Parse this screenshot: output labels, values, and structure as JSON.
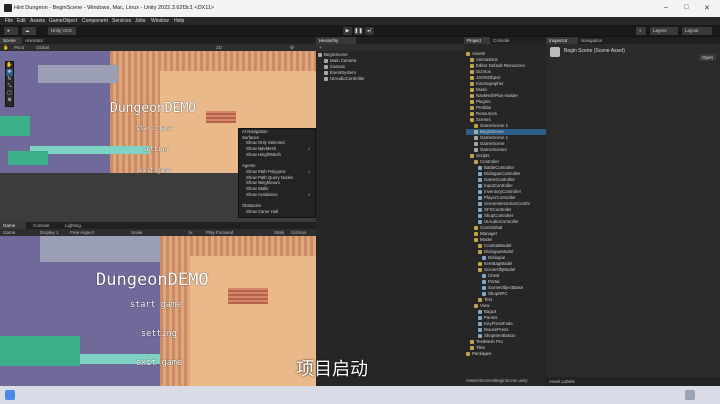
{
  "window": {
    "title": "Hint Dungeon - BeginScene - Windows, Mac, Linux - Unity 2022.3.62f3c1 <DX11>"
  },
  "menu": [
    "File",
    "Edit",
    "Assets",
    "GameObject",
    "Component",
    "Services",
    "Jobs",
    "Window",
    "Help"
  ],
  "toolbar": {
    "account": "Unity VCS",
    "layers": "Layers",
    "layout": "Layout"
  },
  "scene_panel": {
    "tabs": [
      "Scene",
      "Animator"
    ],
    "pivot": "Pivot",
    "global": "Global",
    "mode_2d": "2D"
  },
  "game_panel": {
    "tabs": [
      "Game",
      "Console",
      "Lighting"
    ],
    "display": "Display 1",
    "aspect": "Free Aspect",
    "scale_label": "Scale",
    "scale_value": "1x",
    "play_mode": "Play Focused",
    "stats": "Stats",
    "gizmos": "Gizmos"
  },
  "game_ui": {
    "title": "DungeonDEMO",
    "start": "start game",
    "setting": "setting",
    "exit": "exit game"
  },
  "gizmo_menu": [
    {
      "label": "AI Navigation",
      "header": true,
      "checked": false
    },
    {
      "label": "Surfaces",
      "header": true,
      "checked": false
    },
    {
      "label": "Show Only Selected",
      "header": false,
      "checked": false
    },
    {
      "label": "Show NavMesh",
      "header": false,
      "checked": true
    },
    {
      "label": "Show HeightMesh",
      "header": false,
      "checked": false
    },
    {
      "label": "",
      "header": false,
      "checked": false
    },
    {
      "label": "Agents",
      "header": true,
      "checked": false
    },
    {
      "label": "Show Path Polygons",
      "header": false,
      "checked": true
    },
    {
      "label": "Show Path Query Nodes",
      "header": false,
      "checked": false
    },
    {
      "label": "Show Neighbours",
      "header": false,
      "checked": false
    },
    {
      "label": "Show Walls",
      "header": false,
      "checked": false
    },
    {
      "label": "Show Avoidance",
      "header": false,
      "checked": true
    },
    {
      "label": "",
      "header": false,
      "checked": false
    },
    {
      "label": "Obstacles",
      "header": true,
      "checked": false
    },
    {
      "label": "Show Carve Hull",
      "header": false,
      "checked": false
    }
  ],
  "hierarchy": {
    "tab": "Hierarchy",
    "items": [
      {
        "label": "BeginScene",
        "depth": 0,
        "type": "g"
      },
      {
        "label": "Main Camera",
        "depth": 1,
        "type": "g"
      },
      {
        "label": "Canvas",
        "depth": 1,
        "type": "g"
      },
      {
        "label": "EventSystem",
        "depth": 1,
        "type": "g"
      },
      {
        "label": "UIAudioController",
        "depth": 1,
        "type": "g"
      }
    ]
  },
  "project": {
    "tabs": [
      "Project",
      "Console"
    ],
    "items": [
      {
        "label": "Assets",
        "depth": 0,
        "type": "f",
        "sel": false
      },
      {
        "label": "Animations",
        "depth": 1,
        "type": "f",
        "sel": false
      },
      {
        "label": "Editor Default Resources",
        "depth": 1,
        "type": "f",
        "sel": false
      },
      {
        "label": "Gizmos",
        "depth": 1,
        "type": "f",
        "sel": false
      },
      {
        "label": "JSONObject",
        "depth": 1,
        "type": "f",
        "sel": false
      },
      {
        "label": "Kinetographer",
        "depth": 1,
        "type": "f",
        "sel": false
      },
      {
        "label": "Music",
        "depth": 1,
        "type": "f",
        "sel": false
      },
      {
        "label": "NavMeshPlus-master",
        "depth": 1,
        "type": "f",
        "sel": false
      },
      {
        "label": "Plugins",
        "depth": 1,
        "type": "f",
        "sel": false
      },
      {
        "label": "Prefabs",
        "depth": 1,
        "type": "f",
        "sel": false
      },
      {
        "label": "Resources",
        "depth": 1,
        "type": "f",
        "sel": false
      },
      {
        "label": "Scenes",
        "depth": 1,
        "type": "f",
        "sel": false
      },
      {
        "label": "GameScene 1",
        "depth": 2,
        "type": "f",
        "sel": false
      },
      {
        "label": "BeginScene",
        "depth": 2,
        "type": "g",
        "sel": true
      },
      {
        "label": "GameScene 1",
        "depth": 2,
        "type": "g",
        "sel": false
      },
      {
        "label": "GameScene",
        "depth": 2,
        "type": "g",
        "sel": false
      },
      {
        "label": "GameScene2",
        "depth": 2,
        "type": "g",
        "sel": false
      },
      {
        "label": "Scripts",
        "depth": 1,
        "type": "f",
        "sel": false
      },
      {
        "label": "Controller",
        "depth": 2,
        "type": "f",
        "sel": false
      },
      {
        "label": "BattleController",
        "depth": 3,
        "type": "s",
        "sel": false
      },
      {
        "label": "DialogueController",
        "depth": 3,
        "type": "s",
        "sel": false
      },
      {
        "label": "GameController",
        "depth": 3,
        "type": "s",
        "sel": false
      },
      {
        "label": "InputController",
        "depth": 3,
        "type": "s",
        "sel": false
      },
      {
        "label": "InventoryController",
        "depth": 3,
        "type": "s",
        "sel": false
      },
      {
        "label": "PlayerController",
        "depth": 3,
        "type": "s",
        "sel": false
      },
      {
        "label": "SceneInteractionCombi",
        "depth": 3,
        "type": "s",
        "sel": false
      },
      {
        "label": "SFXController",
        "depth": 3,
        "type": "s",
        "sel": false
      },
      {
        "label": "ShopController",
        "depth": 3,
        "type": "s",
        "sel": false
      },
      {
        "label": "UIAudioController",
        "depth": 3,
        "type": "s",
        "sel": false
      },
      {
        "label": "CoreGlobal",
        "depth": 2,
        "type": "f",
        "sel": false
      },
      {
        "label": "Manager",
        "depth": 2,
        "type": "f",
        "sel": false
      },
      {
        "label": "Model",
        "depth": 2,
        "type": "f",
        "sel": false
      },
      {
        "label": "CombatModel",
        "depth": 3,
        "type": "f",
        "sel": false
      },
      {
        "label": "DialogueModel",
        "depth": 3,
        "type": "f",
        "sel": false
      },
      {
        "label": "Dialogue",
        "depth": 4,
        "type": "s",
        "sel": false
      },
      {
        "label": "ItemBagModel",
        "depth": 3,
        "type": "f",
        "sel": false
      },
      {
        "label": "SceneObjModel",
        "depth": 3,
        "type": "f",
        "sel": false
      },
      {
        "label": "Chest",
        "depth": 4,
        "type": "s",
        "sel": false
      },
      {
        "label": "Portal",
        "depth": 4,
        "type": "s",
        "sel": false
      },
      {
        "label": "SceneObjectBase",
        "depth": 4,
        "type": "s",
        "sel": false
      },
      {
        "label": "ShopNPC",
        "depth": 4,
        "type": "s",
        "sel": false
      },
      {
        "label": "Test",
        "depth": 3,
        "type": "f",
        "sel": false
      },
      {
        "label": "View",
        "depth": 2,
        "type": "f",
        "sel": false
      },
      {
        "label": "BagUI",
        "depth": 3,
        "type": "s",
        "sel": false
      },
      {
        "label": "Panels",
        "depth": 3,
        "type": "s",
        "sel": false
      },
      {
        "label": "KeyPressFade",
        "depth": 3,
        "type": "s",
        "sel": false
      },
      {
        "label": "MousePress",
        "depth": 3,
        "type": "s",
        "sel": false
      },
      {
        "label": "ShopItemButton",
        "depth": 3,
        "type": "s",
        "sel": false
      },
      {
        "label": "TextMesh Pro",
        "depth": 1,
        "type": "f",
        "sel": false
      },
      {
        "label": "Tiles",
        "depth": 1,
        "type": "f",
        "sel": false
      },
      {
        "label": "Packages",
        "depth": 0,
        "type": "f",
        "sel": false
      }
    ],
    "path": "Assets/Scenes/BeginScene.unity",
    "asset_labels": "Asset Labels"
  },
  "inspector": {
    "tabs": [
      "Inspector",
      "Navigation"
    ],
    "title": "Begin Scene (Scene Asset)",
    "open": "Open"
  },
  "subtitle": "项目启动"
}
